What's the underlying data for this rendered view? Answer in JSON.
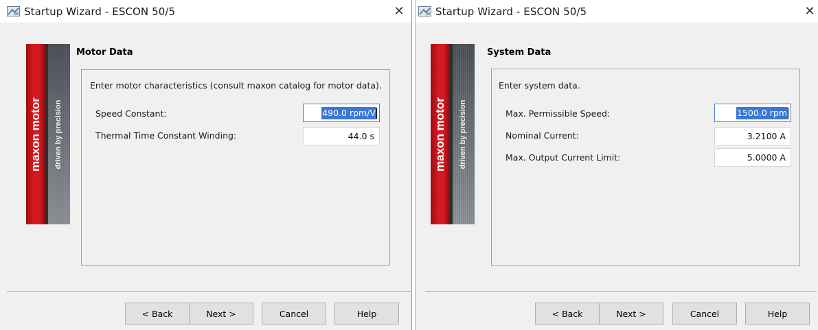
{
  "dialogs": [
    {
      "title": "Startup Wizard - ESCON 50/5",
      "close_glyph": "✕",
      "logo": {
        "brand": "maxon motor",
        "tagline": "driven by precision"
      },
      "heading": "Motor Data",
      "instruction": "Enter motor characteristics (consult maxon catalog for motor data).",
      "fields": [
        {
          "label": "Speed Constant:",
          "value": "490.0 rpm/V",
          "focused": true
        },
        {
          "label": "Thermal Time Constant Winding:",
          "value": "44.0 s",
          "focused": false
        }
      ],
      "buttons": {
        "back": "< Back",
        "next": "Next >",
        "cancel": "Cancel",
        "help": "Help"
      }
    },
    {
      "title": "Startup Wizard - ESCON 50/5",
      "close_glyph": "✕",
      "logo": {
        "brand": "maxon motor",
        "tagline": "driven by precision"
      },
      "heading": "System Data",
      "instruction": "Enter system data.",
      "fields": [
        {
          "label": "Max. Permissible Speed:",
          "value": "1500.0 rpm",
          "focused": true
        },
        {
          "label": "Nominal Current:",
          "value": "3.2100 A",
          "focused": false
        },
        {
          "label": "Max. Output Current Limit:",
          "value": "5.0000 A",
          "focused": false
        }
      ],
      "buttons": {
        "back": "< Back",
        "next": "Next >",
        "cancel": "Cancel",
        "help": "Help"
      }
    }
  ],
  "colors": {
    "brand_red": "#d71920",
    "selection_blue": "#3a78d7",
    "window_bg": "#f0f0f0",
    "button_bg": "#e1e1e1"
  }
}
